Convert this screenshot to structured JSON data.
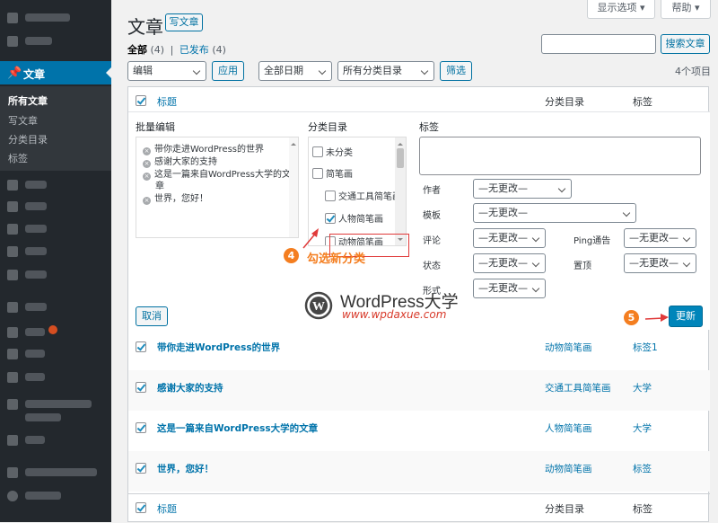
{
  "sidebar": {
    "active_label": "文章",
    "sub_items": [
      "所有文章",
      "写文章",
      "分类目录",
      "标签"
    ]
  },
  "header": {
    "title": "文章",
    "add_new": "写文章",
    "screen_options": "显示选项",
    "help": "帮助"
  },
  "filters": {
    "all_label": "全部",
    "all_count": "(4)",
    "separator": "|",
    "published_label": "已发布",
    "published_count": "(4)",
    "search_button": "搜索文章",
    "bulk_action": "编辑",
    "apply": "应用",
    "date_filter": "全部日期",
    "category_filter": "所有分类目录",
    "filter_button": "筛选",
    "items_count": "4个项目"
  },
  "table": {
    "col_title": "标题",
    "col_category": "分类目录",
    "col_tags": "标签"
  },
  "bulk_edit": {
    "legend": "批量编辑",
    "titles": [
      "带你走进WordPress的世界",
      "感谢大家的支持",
      "这是一篇来自WordPress大学的文",
      "章",
      "世界，您好！"
    ],
    "remove_glyph": "×",
    "categories_legend": "分类目录",
    "categories": [
      {
        "label": "未分类",
        "checked": false
      },
      {
        "label": "简笔画",
        "checked": false
      },
      {
        "label": "交通工具简笔画",
        "checked": false
      },
      {
        "label": "人物简笔画",
        "checked": true
      },
      {
        "label": "动物简笔画",
        "checked": false
      }
    ],
    "tags_legend": "标签",
    "fields": {
      "author": "作者",
      "template": "模板",
      "comments": "评论",
      "ping": "Ping通告",
      "status": "状态",
      "sticky": "置顶",
      "format": "形式"
    },
    "no_change": "—无更改—",
    "cancel": "取消",
    "update": "更新"
  },
  "annotations": {
    "step4_number": "4",
    "step4_text": "勾选新分类",
    "step5_number": "5",
    "accent_color": "#f47e20",
    "highlight_color": "#e03a3a"
  },
  "watermark": {
    "brand": "WordPress大学",
    "url": "www.wpdaxue.com"
  },
  "rows": [
    {
      "title": "带你走进WordPress的世界",
      "category": "动物简笔画",
      "tag": "标签1"
    },
    {
      "title": "感谢大家的支持",
      "category": "交通工具简笔画",
      "tag": "大学"
    },
    {
      "title": "这是一篇来自WordPress大学的文章",
      "category": "人物简笔画",
      "tag": "大学"
    },
    {
      "title": "世界，您好！",
      "category": "动物简笔画",
      "tag": "标签"
    }
  ]
}
